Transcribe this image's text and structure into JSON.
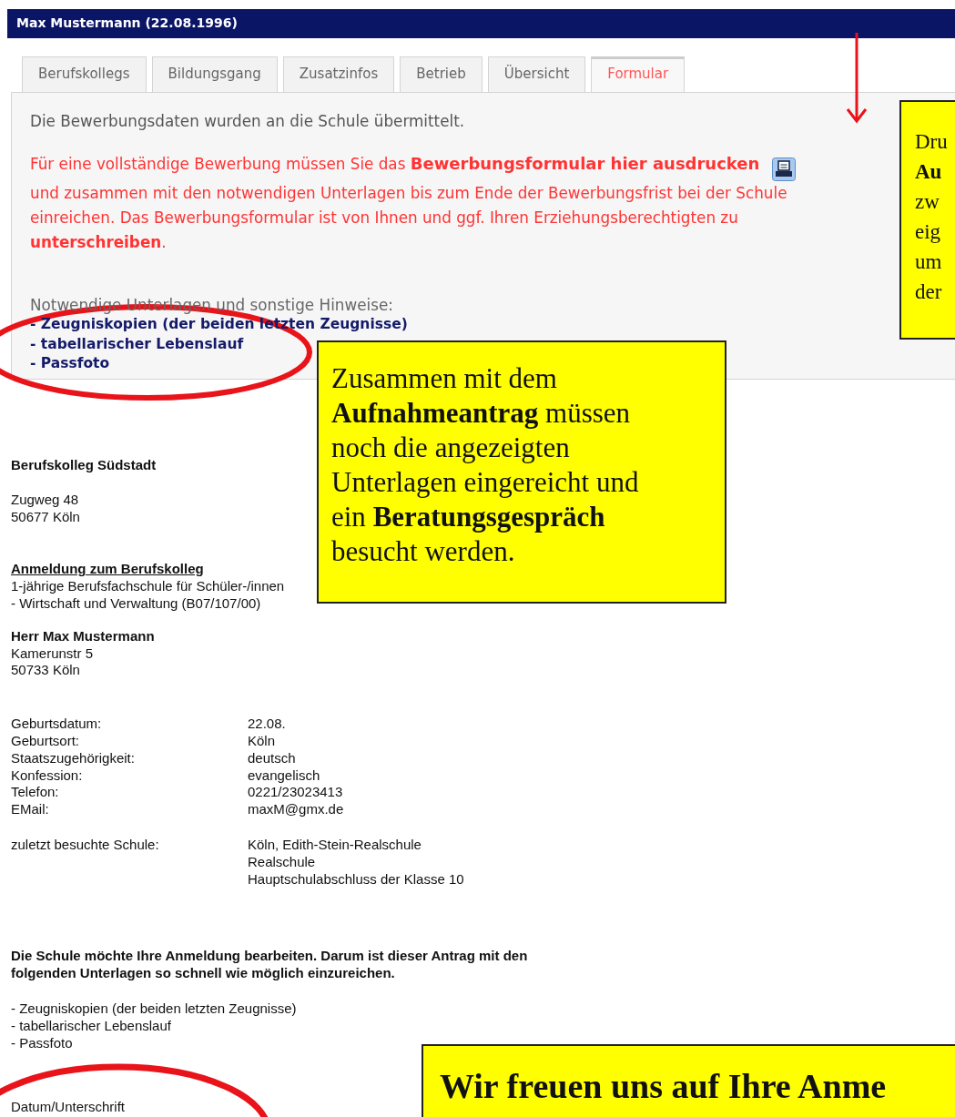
{
  "header": {
    "title": "Max Mustermann (22.08.1996)"
  },
  "tabs": [
    {
      "label": "Berufskollegs",
      "selected": false
    },
    {
      "label": "Bildungsgang",
      "selected": false
    },
    {
      "label": "Zusatzinfos",
      "selected": false
    },
    {
      "label": "Betrieb",
      "selected": false
    },
    {
      "label": "Übersicht",
      "selected": false
    },
    {
      "label": "Formular",
      "selected": true
    }
  ],
  "panel": {
    "status_message": "Die Bewerbungsdaten wurden an die Schule übermittelt.",
    "notice_start": "Für eine vollständige Bewerbung müssen Sie das",
    "print_link": "Bewerbungsformular hier ausdrucken",
    "notice_end": [
      "und zusammen mit den notwendigen Unterlagen bis zum Ende der Bewerbungsfrist bei der Schule",
      "einreichen. Das Bewerbungsformular ist von Ihnen und ggf. Ihren Erziehungsberechtigten zu",
      "**unterschreiben**."
    ],
    "documents_heading": "Notwendige Unterlagen und sonstige Hinweise:",
    "documents": [
      "- Zeugniskopien (der beiden letzten Zeugnisse)",
      "- tabellarischer Lebenslauf",
      "- Passfoto"
    ]
  },
  "form": {
    "school_name": "Berufskolleg Südstadt",
    "school_address": [
      "Zugweg 48",
      "50677 Köln"
    ],
    "title": "Anmeldung zum Berufskolleg",
    "program": [
      "1-jährige Berufsfachschule für Schüler-/innen",
      "- Wirtschaft und Verwaltung (B07/107/00)"
    ],
    "applicant_name": "Herr Max Mustermann",
    "applicant_address": [
      "Kamerunstr 5",
      "50733 Köln"
    ],
    "fields": [
      {
        "label": "Geburtsdatum:",
        "values": [
          "22.08."
        ]
      },
      {
        "label": "Geburtsort:",
        "values": [
          "Köln"
        ]
      },
      {
        "label": "Staatszugehörigkeit:",
        "values": [
          "deutsch"
        ]
      },
      {
        "label": "Konfession:",
        "values": [
          "evangelisch"
        ]
      },
      {
        "label": "Telefon:",
        "values": [
          "0221/23023413"
        ]
      },
      {
        "label": "EMail:",
        "values": [
          "maxM@gmx.de"
        ]
      }
    ],
    "school_fields": [
      {
        "label": "zuletzt besuchte Schule:",
        "values": [
          "Köln, Edith-Stein-Realschule",
          "Realschule",
          "Hauptschulabschluss der Klasse 10"
        ]
      }
    ],
    "note": "Die Schule möchte Ihre Anmeldung bearbeiten. Darum ist dieser Antrag mit den folgenden Unterlagen so schnell wie möglich einzureichen.",
    "documents": [
      "- Zeugniskopien (der beiden letzten Zeugnisse)",
      "- tabellarischer Lebenslauf",
      "- Passfoto"
    ],
    "signature_label": "Datum/Unterschrift"
  },
  "callouts": [
    {
      "kind": "side",
      "lines": [
        "Dru",
        "**Au**",
        "zw",
        "eig",
        "um",
        "der"
      ]
    },
    {
      "kind": "middle",
      "lines": [
        "Zusammen mit dem",
        "**Aufnahmeantrag**  müssen",
        "noch die angezeigten",
        "Unterlagen eingereicht  und",
        "ein **Beratungsgespräch**",
        "besucht werden."
      ]
    },
    {
      "kind": "bottom",
      "text": "Wir freuen uns auf Ihre Anme"
    }
  ]
}
